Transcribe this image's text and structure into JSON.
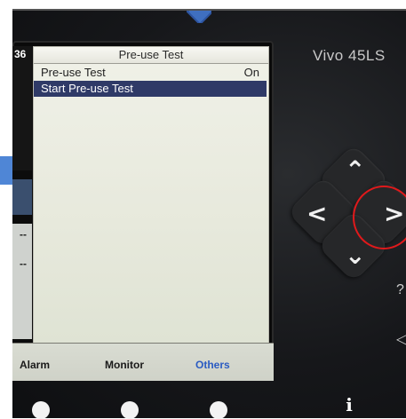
{
  "device": {
    "brand": "Vivo 45LS",
    "screen_id_fragment": "36"
  },
  "dialog": {
    "title": "Pre-use Test",
    "rows": [
      {
        "label": "Pre-use Test",
        "value": "On",
        "selected": false
      },
      {
        "label": "Start Pre-use Test",
        "value": "",
        "selected": true
      }
    ]
  },
  "left_strip": {
    "dash_1": "--",
    "dash_2": "--"
  },
  "tabs": [
    {
      "label": "Alarm",
      "active": false
    },
    {
      "label": "Monitor",
      "active": false
    },
    {
      "label": "Others",
      "active": true
    }
  ],
  "navigation": {
    "up_icon": "chevron-up-icon",
    "left_icon": "chevron-left-icon",
    "right_icon": "chevron-right-icon",
    "down_icon": "chevron-down-icon",
    "highlighted": "right"
  },
  "colors": {
    "selected_row": "#2f3a67",
    "active_tab": "#2a5bc2",
    "highlight_ring": "#e0191b",
    "pointer_blue": "#4f86d6"
  }
}
